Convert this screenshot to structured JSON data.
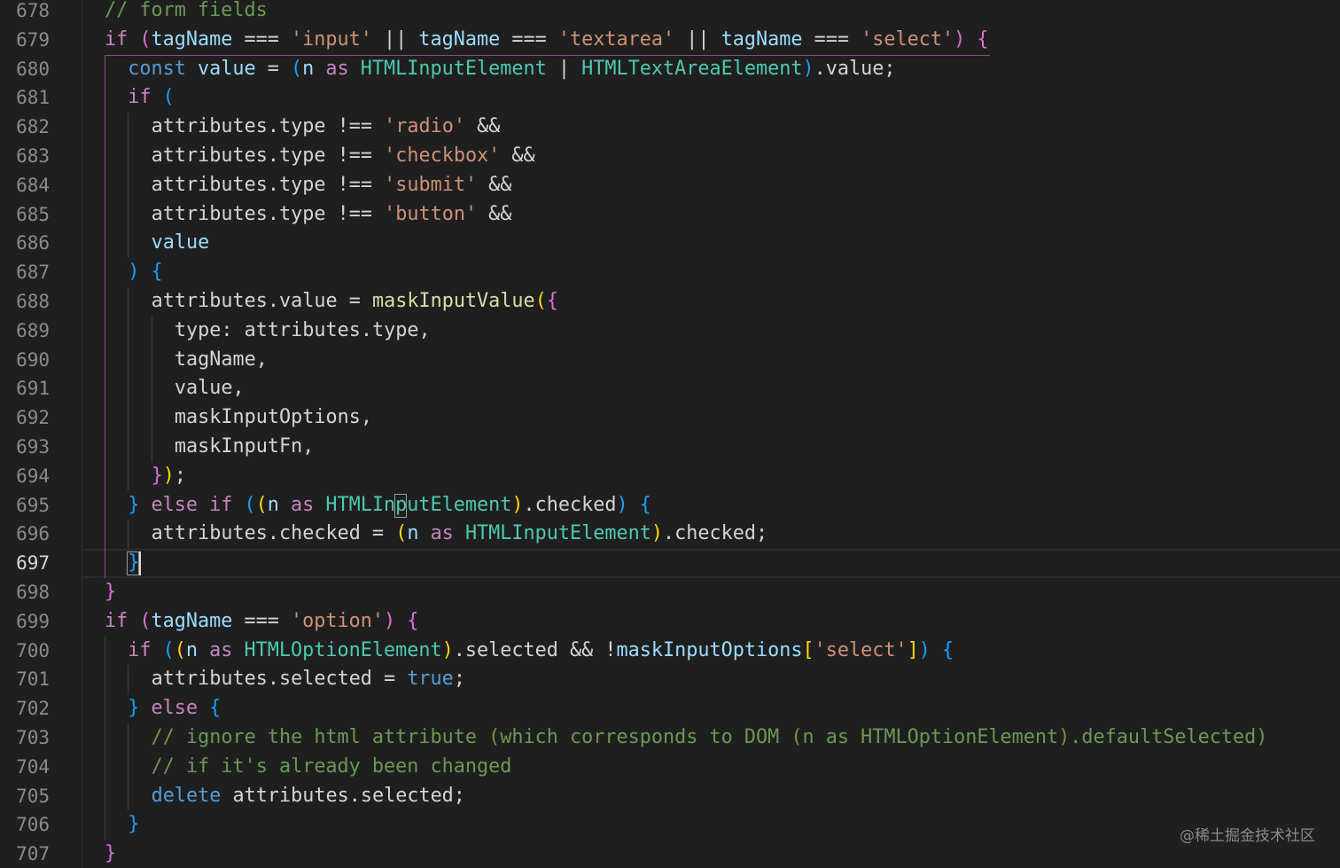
{
  "editor": {
    "active_line": 697,
    "watermark": "@稀土掘金技术社区"
  },
  "lines": [
    {
      "n": 678,
      "indent": 1,
      "tokens": [
        [
          "// form fields",
          "com"
        ]
      ]
    },
    {
      "n": 679,
      "indent": 1,
      "tokens": [
        [
          "if",
          "ctl"
        ],
        [
          " ",
          "plain"
        ],
        [
          "(",
          "b2"
        ],
        [
          "tagName",
          "var"
        ],
        [
          " === ",
          "op"
        ],
        [
          "'input'",
          "str"
        ],
        [
          " || ",
          "op"
        ],
        [
          "tagName",
          "var"
        ],
        [
          " === ",
          "op"
        ],
        [
          "'textarea'",
          "str"
        ],
        [
          " || ",
          "op"
        ],
        [
          "tagName",
          "var"
        ],
        [
          " === ",
          "op"
        ],
        [
          "'select'",
          "str"
        ],
        [
          ")",
          "b2"
        ],
        [
          " ",
          "plain"
        ],
        [
          "{",
          "b2"
        ]
      ]
    },
    {
      "n": 680,
      "indent": 2,
      "tokens": [
        [
          "const",
          "kw"
        ],
        [
          " ",
          "plain"
        ],
        [
          "value",
          "var"
        ],
        [
          " = ",
          "op"
        ],
        [
          "(",
          "b3"
        ],
        [
          "n",
          "var"
        ],
        [
          " ",
          "plain"
        ],
        [
          "as",
          "ctl"
        ],
        [
          " ",
          "plain"
        ],
        [
          "HTMLInputElement",
          "type"
        ],
        [
          " | ",
          "op"
        ],
        [
          "HTMLTextAreaElement",
          "type"
        ],
        [
          ")",
          "b3"
        ],
        [
          ".value;",
          "prop"
        ]
      ]
    },
    {
      "n": 681,
      "indent": 2,
      "tokens": [
        [
          "if",
          "ctl"
        ],
        [
          " ",
          "plain"
        ],
        [
          "(",
          "b3"
        ]
      ]
    },
    {
      "n": 682,
      "indent": 3,
      "tokens": [
        [
          "attributes",
          "prop"
        ],
        [
          ".type",
          "prop"
        ],
        [
          " !== ",
          "op"
        ],
        [
          "'radio'",
          "str"
        ],
        [
          " &&",
          "op"
        ]
      ]
    },
    {
      "n": 683,
      "indent": 3,
      "tokens": [
        [
          "attributes",
          "prop"
        ],
        [
          ".type",
          "prop"
        ],
        [
          " !== ",
          "op"
        ],
        [
          "'checkbox'",
          "str"
        ],
        [
          " &&",
          "op"
        ]
      ]
    },
    {
      "n": 684,
      "indent": 3,
      "tokens": [
        [
          "attributes",
          "prop"
        ],
        [
          ".type",
          "prop"
        ],
        [
          " !== ",
          "op"
        ],
        [
          "'submit'",
          "str"
        ],
        [
          " &&",
          "op"
        ]
      ]
    },
    {
      "n": 685,
      "indent": 3,
      "tokens": [
        [
          "attributes",
          "prop"
        ],
        [
          ".type",
          "prop"
        ],
        [
          " !== ",
          "op"
        ],
        [
          "'button'",
          "str"
        ],
        [
          " &&",
          "op"
        ]
      ]
    },
    {
      "n": 686,
      "indent": 3,
      "tokens": [
        [
          "value",
          "var"
        ]
      ]
    },
    {
      "n": 687,
      "indent": 2,
      "tokens": [
        [
          ")",
          "b3"
        ],
        [
          " ",
          "plain"
        ],
        [
          "{",
          "b3"
        ]
      ]
    },
    {
      "n": 688,
      "indent": 3,
      "tokens": [
        [
          "attributes",
          "prop"
        ],
        [
          ".value",
          "prop"
        ],
        [
          " = ",
          "op"
        ],
        [
          "maskInputValue",
          "fn"
        ],
        [
          "(",
          "b1"
        ],
        [
          "{",
          "b2"
        ]
      ]
    },
    {
      "n": 689,
      "indent": 4,
      "tokens": [
        [
          "type",
          "prop"
        ],
        [
          ": ",
          "op"
        ],
        [
          "attributes",
          "prop"
        ],
        [
          ".type,",
          "prop"
        ]
      ]
    },
    {
      "n": 690,
      "indent": 4,
      "tokens": [
        [
          "tagName,",
          "prop"
        ]
      ]
    },
    {
      "n": 691,
      "indent": 4,
      "tokens": [
        [
          "value,",
          "prop"
        ]
      ]
    },
    {
      "n": 692,
      "indent": 4,
      "tokens": [
        [
          "maskInputOptions,",
          "prop"
        ]
      ]
    },
    {
      "n": 693,
      "indent": 4,
      "tokens": [
        [
          "maskInputFn,",
          "prop"
        ]
      ]
    },
    {
      "n": 694,
      "indent": 3,
      "tokens": [
        [
          "}",
          "b2"
        ],
        [
          ")",
          "b1"
        ],
        [
          ";",
          "op"
        ]
      ]
    },
    {
      "n": 695,
      "indent": 2,
      "tokens": [
        [
          "}",
          "b3"
        ],
        [
          " ",
          "plain"
        ],
        [
          "else",
          "ctl"
        ],
        [
          " ",
          "plain"
        ],
        [
          "if",
          "ctl"
        ],
        [
          " ",
          "plain"
        ],
        [
          "(",
          "b3"
        ],
        [
          "(",
          "b1"
        ],
        [
          "n",
          "var"
        ],
        [
          " ",
          "plain"
        ],
        [
          "as",
          "ctl"
        ],
        [
          " ",
          "plain"
        ],
        [
          "HTMLInputElement",
          "type"
        ],
        [
          ")",
          "b1"
        ],
        [
          ".checked",
          "prop"
        ],
        [
          ")",
          "b3"
        ],
        [
          " ",
          "plain"
        ],
        [
          "{",
          "b3"
        ]
      ]
    },
    {
      "n": 696,
      "indent": 3,
      "tokens": [
        [
          "attributes",
          "prop"
        ],
        [
          ".checked",
          "prop"
        ],
        [
          " = ",
          "op"
        ],
        [
          "(",
          "b1"
        ],
        [
          "n",
          "var"
        ],
        [
          " ",
          "plain"
        ],
        [
          "as",
          "ctl"
        ],
        [
          " ",
          "plain"
        ],
        [
          "HTMLInputElement",
          "type"
        ],
        [
          ")",
          "b1"
        ],
        [
          ".checked;",
          "prop"
        ]
      ]
    },
    {
      "n": 697,
      "indent": 2,
      "tokens": [
        [
          "}",
          "b3"
        ]
      ]
    },
    {
      "n": 698,
      "indent": 1,
      "tokens": [
        [
          "}",
          "b2"
        ]
      ]
    },
    {
      "n": 699,
      "indent": 1,
      "tokens": [
        [
          "if",
          "ctl"
        ],
        [
          " ",
          "plain"
        ],
        [
          "(",
          "b2"
        ],
        [
          "tagName",
          "var"
        ],
        [
          " === ",
          "op"
        ],
        [
          "'option'",
          "str"
        ],
        [
          ")",
          "b2"
        ],
        [
          " ",
          "plain"
        ],
        [
          "{",
          "b2"
        ]
      ]
    },
    {
      "n": 700,
      "indent": 2,
      "tokens": [
        [
          "if",
          "ctl"
        ],
        [
          " ",
          "plain"
        ],
        [
          "(",
          "b3"
        ],
        [
          "(",
          "b1"
        ],
        [
          "n",
          "var"
        ],
        [
          " ",
          "plain"
        ],
        [
          "as",
          "ctl"
        ],
        [
          " ",
          "plain"
        ],
        [
          "HTMLOptionElement",
          "type"
        ],
        [
          ")",
          "b1"
        ],
        [
          ".selected",
          "prop"
        ],
        [
          " && ",
          "op"
        ],
        [
          "!",
          "op"
        ],
        [
          "maskInputOptions",
          "var"
        ],
        [
          "[",
          "b1"
        ],
        [
          "'select'",
          "str"
        ],
        [
          "]",
          "b1"
        ],
        [
          ")",
          "b3"
        ],
        [
          " ",
          "plain"
        ],
        [
          "{",
          "b3"
        ]
      ]
    },
    {
      "n": 701,
      "indent": 3,
      "tokens": [
        [
          "attributes",
          "prop"
        ],
        [
          ".selected",
          "prop"
        ],
        [
          " = ",
          "op"
        ],
        [
          "true",
          "kw"
        ],
        [
          ";",
          "op"
        ]
      ]
    },
    {
      "n": 702,
      "indent": 2,
      "tokens": [
        [
          "}",
          "b3"
        ],
        [
          " ",
          "plain"
        ],
        [
          "else",
          "ctl"
        ],
        [
          " ",
          "plain"
        ],
        [
          "{",
          "b3"
        ]
      ]
    },
    {
      "n": 703,
      "indent": 3,
      "tokens": [
        [
          "// ignore the html attribute (which corresponds to DOM (n as HTMLOptionElement).defaultSelected)",
          "com"
        ]
      ]
    },
    {
      "n": 704,
      "indent": 3,
      "tokens": [
        [
          "// if it's already been changed",
          "com"
        ]
      ]
    },
    {
      "n": 705,
      "indent": 3,
      "tokens": [
        [
          "delete",
          "kw"
        ],
        [
          " ",
          "plain"
        ],
        [
          "attributes",
          "prop"
        ],
        [
          ".selected;",
          "prop"
        ]
      ]
    },
    {
      "n": 706,
      "indent": 2,
      "tokens": [
        [
          "}",
          "b3"
        ]
      ]
    },
    {
      "n": 707,
      "indent": 1,
      "tokens": [
        [
          "}",
          "b2"
        ]
      ]
    }
  ],
  "colors": {
    "background": "#1f1f1f",
    "keyword": "#569cd6",
    "control": "#c586c0",
    "variable": "#9cdcfe",
    "string": "#ce9178",
    "type": "#4ec9b0",
    "function": "#dcdcaa",
    "comment": "#6a9955",
    "bracket_1": "#ffd700",
    "bracket_2": "#da70d6",
    "bracket_3": "#179fff"
  }
}
